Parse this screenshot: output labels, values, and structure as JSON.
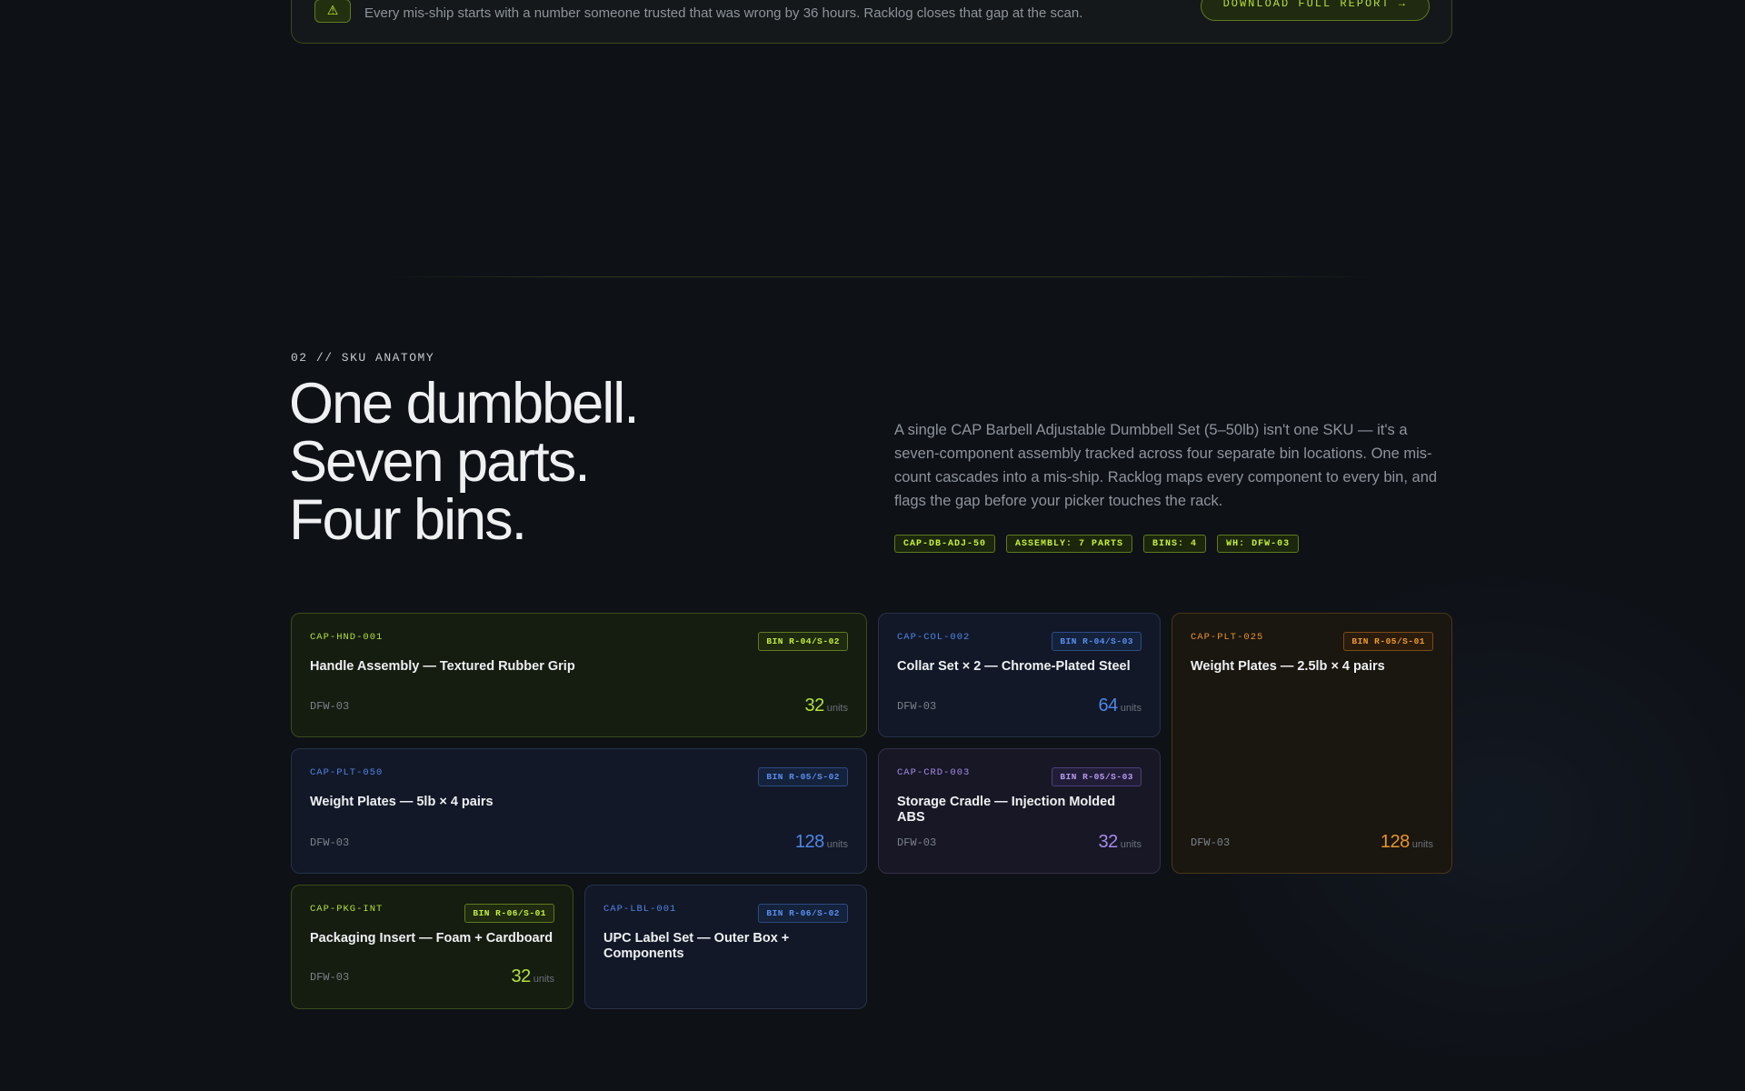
{
  "banner": {
    "icon": "warning-icon",
    "text": "Every mis-ship starts with a number someone trusted that was wrong by 36 hours. Racklog closes that gap at the scan.",
    "button_label": "DOWNLOAD FULL REPORT →"
  },
  "section": {
    "eyebrow": "02 // SKU ANATOMY",
    "headline": [
      "One dumbbell.",
      "Seven parts.",
      "Four bins."
    ],
    "intro": "A single CAP Barbell Adjustable Dumbbell Set (5–50lb) isn't one SKU — it's a seven-component assembly tracked across four separate bin locations. One mis-count cascades into a mis-ship. Racklog maps every component to every bin, and flags the gap before your picker touches the rack.",
    "tags": [
      "CAP-DB-ADJ-50",
      "ASSEMBLY: 7 PARTS",
      "BINS: 4",
      "WH: DFW-03"
    ]
  },
  "cards": [
    {
      "code": "CAP-HND-001",
      "bin": "BIN R-04/S-02",
      "title": "Handle Assembly — Textured Rubber Grip",
      "warehouse": "DFW-03",
      "qty": "32",
      "unit": "units",
      "accent": "green"
    },
    {
      "code": "CAP-COL-002",
      "bin": "BIN R-04/S-03",
      "title": "Collar Set × 2 — Chrome-Plated Steel",
      "warehouse": "DFW-03",
      "qty": "64",
      "unit": "units",
      "accent": "blue"
    },
    {
      "code": "CAP-PLT-025",
      "bin": "BIN R-05/S-01",
      "title": "Weight Plates — 2.5lb × 4 pairs",
      "warehouse": "DFW-03",
      "qty": "128",
      "unit": "units",
      "accent": "orange"
    },
    {
      "code": "CAP-PLT-050",
      "bin": "BIN R-05/S-02",
      "title": "Weight Plates — 5lb × 4 pairs",
      "warehouse": "DFW-03",
      "qty": "128",
      "unit": "units",
      "accent": "blue"
    },
    {
      "code": "CAP-CRD-003",
      "bin": "BIN R-05/S-03",
      "title": "Storage Cradle — Injection Molded ABS",
      "warehouse": "DFW-03",
      "qty": "32",
      "unit": "units",
      "accent": "purple"
    },
    {
      "code": "CAP-PKG-INT",
      "bin": "BIN R-06/S-01",
      "title": "Packaging Insert — Foam + Cardboard",
      "warehouse": "DFW-03",
      "qty": "32",
      "unit": "units",
      "accent": "green"
    },
    {
      "code": "CAP-LBL-001",
      "bin": "BIN R-06/S-02",
      "title": "UPC Label Set — Outer Box + Components",
      "warehouse": "",
      "qty": "",
      "unit": "",
      "accent": "blue"
    }
  ]
}
